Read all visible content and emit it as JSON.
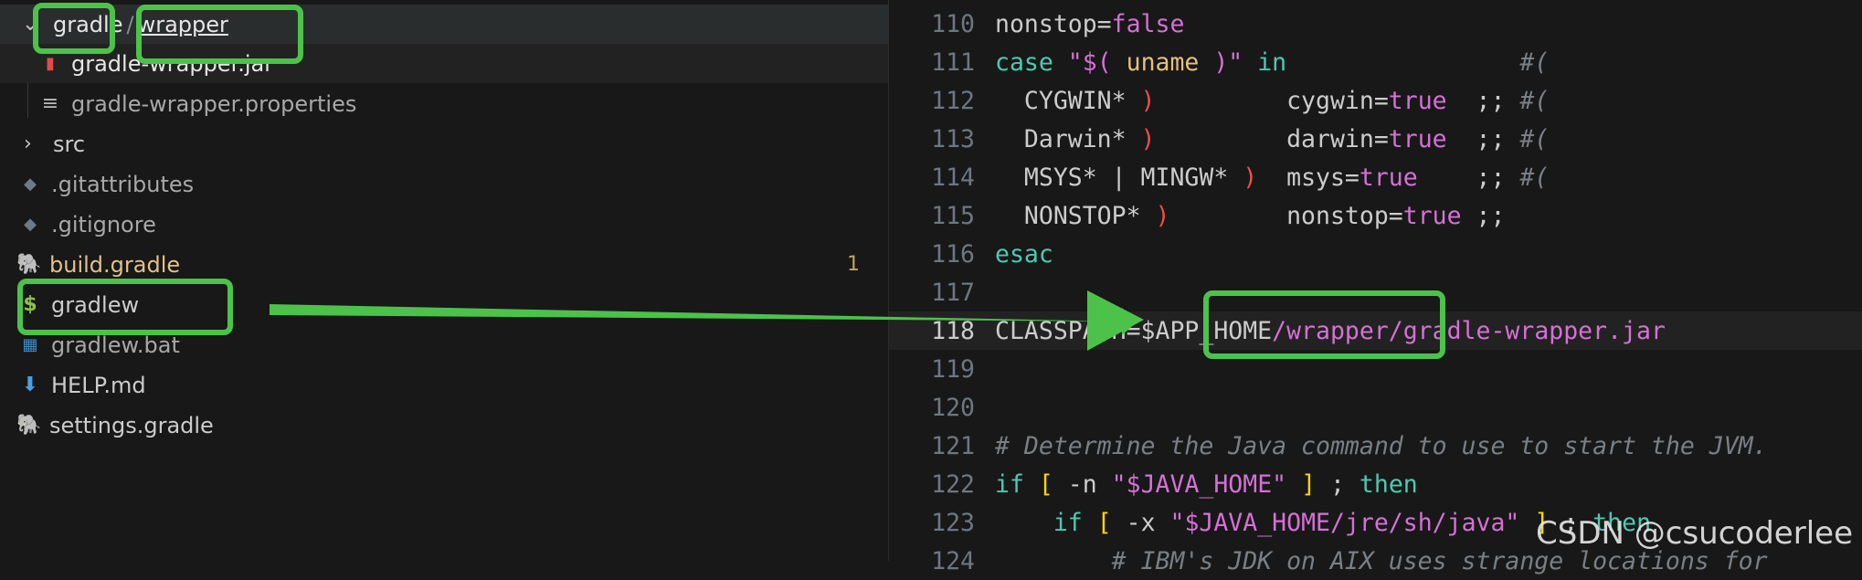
{
  "explorer": {
    "folder_path": {
      "part1": "gradle",
      "separator": "/",
      "part2": "wrapper"
    },
    "items": [
      {
        "label": "gradle-wrapper.jar"
      },
      {
        "label": "gradle-wrapper.properties"
      },
      {
        "label": "src"
      },
      {
        "label": ".gitattributes"
      },
      {
        "label": ".gitignore"
      },
      {
        "label": "build.gradle",
        "badge": "1"
      },
      {
        "label": "gradlew"
      },
      {
        "label": "gradlew.bat"
      },
      {
        "label": "HELP.md"
      },
      {
        "label": "settings.gradle"
      }
    ]
  },
  "editor": {
    "lines": [
      {
        "n": "110"
      },
      {
        "n": "111"
      },
      {
        "n": "112"
      },
      {
        "n": "113"
      },
      {
        "n": "114"
      },
      {
        "n": "115"
      },
      {
        "n": "116"
      },
      {
        "n": "117"
      },
      {
        "n": "118"
      },
      {
        "n": "119"
      },
      {
        "n": "120"
      },
      {
        "n": "121"
      },
      {
        "n": "122"
      },
      {
        "n": "123"
      },
      {
        "n": "124"
      }
    ],
    "t": {
      "l110a": "nonstop=",
      "l110b": "false",
      "l111a": "case",
      "l111b": " \"$(",
      "l111c": " uname ",
      "l111d": ")\"",
      "l111e": " in",
      "l111f": "                #(",
      "l112a": "  CYGWIN* ",
      "l112b": ")",
      "l112c": "         cygwin=",
      "l112d": "true",
      "l112e": "  ;; ",
      "l112f": "#(",
      "l113a": "  Darwin* ",
      "l113b": ")",
      "l113c": "         darwin=",
      "l113d": "true",
      "l113e": "  ;; ",
      "l113f": "#(",
      "l114a": "  MSYS* | MINGW* ",
      "l114b": ")",
      "l114c": "  msys=",
      "l114d": "true",
      "l114e": "    ;; ",
      "l114f": "#(",
      "l115a": "  NONSTOP* ",
      "l115b": ")",
      "l115c": "        nonstop=",
      "l115d": "true",
      "l115e": " ;;",
      "l116a": "esac",
      "l118a": "CLASSPATH=$APP_HOME",
      "l118b": "/wrapper/gradle-wrapper.jar",
      "l121a": "# Determine the Java command to use to start the JVM.",
      "l122a": "if",
      "l122b": " [",
      "l122c": " -n ",
      "l122d": "\"$JAVA_HOME\"",
      "l122e": " ]",
      "l122f": " ; ",
      "l122g": "then",
      "l123a": "    if",
      "l123b": " [",
      "l123c": " -x ",
      "l123d": "\"$JAVA_HOME",
      "l123e": "/jre/sh/java\"",
      "l123f": " ]",
      "l123g": " ; ",
      "l123h": "then",
      "l124a": "        # IBM's JDK on AIX uses strange locations for"
    }
  },
  "watermark": "CSDN @csucoderlee",
  "colors": {
    "annotation": "#4cc24a",
    "keyword": "#4ec9b0",
    "string_value": "#d670d6"
  }
}
